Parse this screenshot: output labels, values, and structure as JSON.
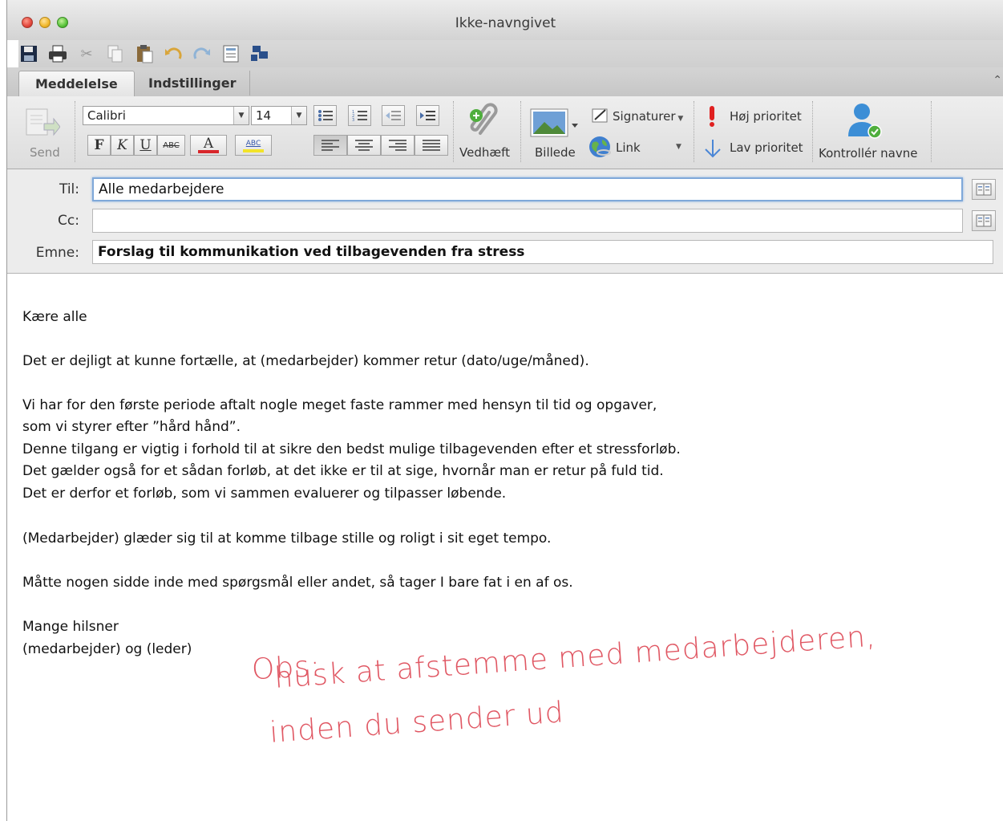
{
  "window": {
    "title": "Ikke-navngivet"
  },
  "tabs": [
    "Meddelelse",
    "Indstillinger"
  ],
  "ribbon": {
    "send_label": "Send",
    "font_name": "Calibri",
    "font_size": "14",
    "bold": "F",
    "italic": "K",
    "underline": "U",
    "strike": "ABC",
    "font_color": "A",
    "highlight": "ABC",
    "attach_label": "Vedhæft",
    "picture_label": "Billede",
    "signatures_label": "Signaturer",
    "link_label": "Link",
    "high_priority_label": "Høj prioritet",
    "low_priority_label": "Lav prioritet",
    "check_names_label": "Kontrollér navne"
  },
  "fields": {
    "to_label": "Til:",
    "to_value": "Alle medarbejdere",
    "cc_label": "Cc:",
    "cc_value": "",
    "subject_label": "Emne:",
    "subject_value": "Forslag til kommunikation ved tilbagevenden fra stress"
  },
  "body": {
    "greeting": "Kære alle",
    "p1": "Det er dejligt at kunne fortælle, at (medarbejder) kommer retur (dato/uge/måned).",
    "p2_l1": "Vi har for den første periode aftalt nogle meget faste rammer med hensyn til tid og opgaver,",
    "p2_l2": "som vi styrer efter ”hård hånd”.",
    "p2_l3": "Denne tilgang er vigtig i forhold til at sikre den bedst mulige tilbagevenden efter et stressforløb.",
    "p2_l4": "Det gælder også for et sådan forløb, at det ikke er til at sige, hvornår man er retur på fuld tid.",
    "p2_l5": "Det er derfor et forløb, som vi sammen evaluerer og tilpasser løbende.",
    "p3": "(Medarbejder) glæder sig til at komme tilbage stille og roligt i sit eget tempo.",
    "p4": "Måtte nogen sidde inde med spørgsmål eller andet, så tager I bare fat i en af os.",
    "closing_l1": "Mange hilsner",
    "closing_l2": "(medarbejder) og (leder)"
  },
  "note": {
    "line1": "Obs:",
    "line2": "husk at afstemme med medarbejderen,",
    "line3": "inden du sender ud"
  },
  "colors": {
    "note": "#e05763",
    "font_color_bar": "#d8262b",
    "highlight_bar": "#f2e32a",
    "focus_border": "#7fa8d9"
  }
}
